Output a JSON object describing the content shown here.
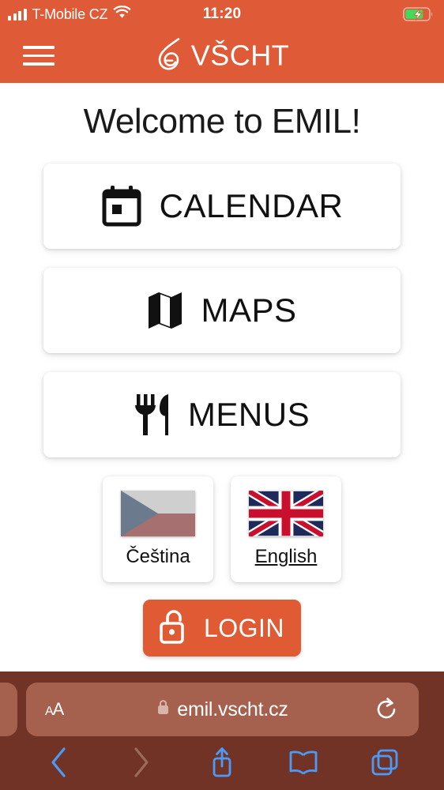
{
  "status_bar": {
    "carrier": "T-Mobile CZ",
    "signal_icon": "cellular-bars-icon",
    "wifi_icon": "wifi-icon",
    "time": "11:20",
    "battery_icon": "battery-charging-icon",
    "battery_color": "#3DDC5C"
  },
  "app_header": {
    "menu_icon": "hamburger-menu-icon",
    "logo_icon": "vscht-drop-e-logo-icon",
    "brand": "VŠCHT",
    "background_color": "#DF5B37"
  },
  "main": {
    "heading": "Welcome to EMIL!",
    "nav_cards": [
      {
        "label": "CALENDAR",
        "icon": "calendar-icon"
      },
      {
        "label": "MAPS",
        "icon": "map-icon"
      },
      {
        "label": "MENUS",
        "icon": "utensils-icon"
      }
    ],
    "languages": [
      {
        "label": "Čeština",
        "flag": "czech-flag-icon",
        "active": false
      },
      {
        "label": "English",
        "flag": "uk-flag-icon",
        "active": true
      }
    ],
    "login": {
      "label": "LOGIN",
      "icon": "unlock-padlock-icon",
      "color": "#E05A33"
    }
  },
  "browser": {
    "text_size_label": "A",
    "text_size_label_small": "A",
    "lock_icon": "lock-icon",
    "url": "emil.vscht.cz",
    "reload_icon": "reload-icon",
    "toolbar": [
      {
        "name": "back-button",
        "icon": "chevron-left-icon",
        "enabled": true
      },
      {
        "name": "forward-button",
        "icon": "chevron-right-icon",
        "enabled": false
      },
      {
        "name": "share-button",
        "icon": "share-icon",
        "enabled": true
      },
      {
        "name": "bookmarks-button",
        "icon": "book-icon",
        "enabled": true
      },
      {
        "name": "tabs-button",
        "icon": "tabs-icon",
        "enabled": true
      }
    ],
    "bar_color": "#713325",
    "field_color": "#A5614E",
    "accent_color": "#4A9BF7"
  }
}
